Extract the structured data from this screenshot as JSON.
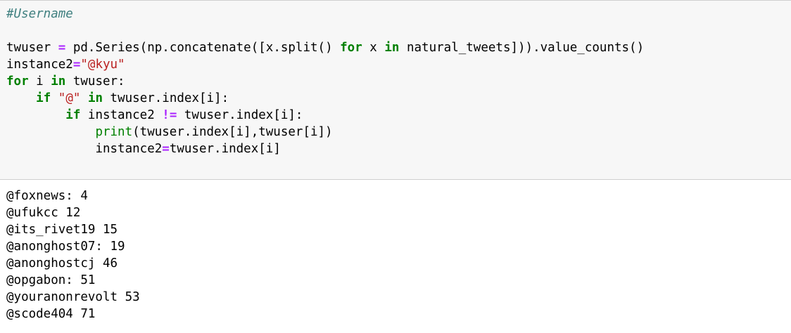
{
  "cell": {
    "comment": "#Username",
    "code": {
      "l2_a": "twuser ",
      "l2_eq": "=",
      "l2_b": " pd.Series(np.concatenate([x.split() ",
      "l2_for": "for",
      "l2_c": " x ",
      "l2_in": "in",
      "l2_d": " natural_tweets])).value_counts()",
      "l3_a": "instance2",
      "l3_eq": "=",
      "l3_str": "\"@kyu\"",
      "l4_for": "for",
      "l4_a": " i ",
      "l4_in": "in",
      "l4_b": " twuser:",
      "l5_indent": "    ",
      "l5_if": "if",
      "l5_sp": " ",
      "l5_str": "\"@\"",
      "l5_sp2": " ",
      "l5_in": "in",
      "l5_b": " twuser.index[i]:",
      "l6_indent": "        ",
      "l6_if": "if",
      "l6_a": " instance2 ",
      "l6_neq": "!=",
      "l6_b": " twuser.index[i]:",
      "l7_indent": "            ",
      "l7_print": "print",
      "l7_a": "(twuser.index[i],twuser[i])",
      "l8_indent": "            ",
      "l8_a": "instance2",
      "l8_eq": "=",
      "l8_b": "twuser.index[i]"
    }
  },
  "output": {
    "lines": [
      "@foxnews: 4",
      "@ufukcc 12",
      "@its_rivet19 15",
      "@anonghost07: 19",
      "@anonghostcj 46",
      "@opgabon: 51",
      "@youranonrevolt 53",
      "@scode404 71"
    ]
  },
  "colors": {
    "comment": "#408080",
    "keyword": "#008000",
    "operator": "#aa22ff",
    "string": "#ba2121",
    "input_background": "#f7f7f7",
    "border": "#cfcfcf"
  }
}
